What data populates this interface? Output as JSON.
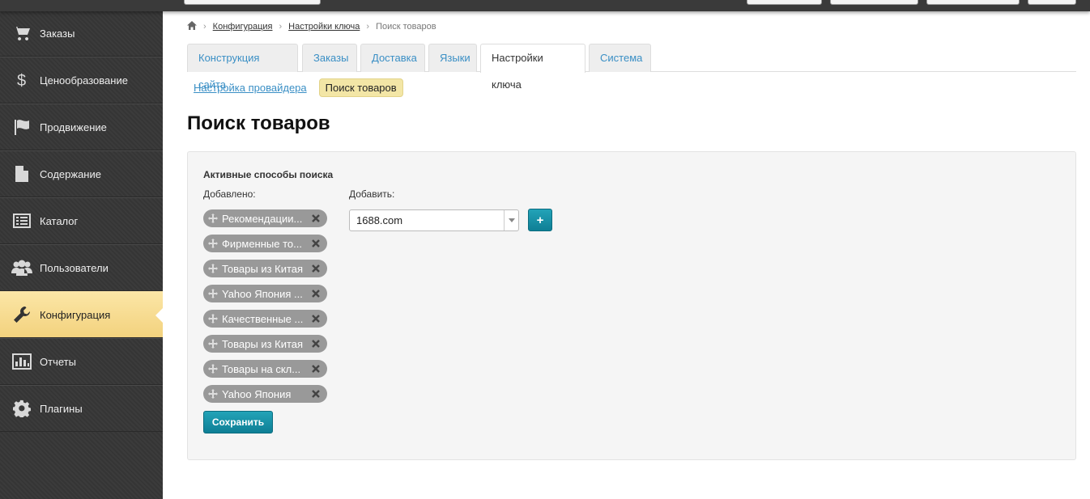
{
  "sidebar": {
    "items": [
      {
        "label": "Заказы",
        "icon": "cart-icon"
      },
      {
        "label": "Ценообразование",
        "icon": "dollar-icon"
      },
      {
        "label": "Продвижение",
        "icon": "flag-icon"
      },
      {
        "label": "Содержание",
        "icon": "file-icon"
      },
      {
        "label": "Каталог",
        "icon": "list-icon"
      },
      {
        "label": "Пользователи",
        "icon": "users-icon"
      },
      {
        "label": "Конфигурация",
        "icon": "wrench-icon",
        "active": true
      },
      {
        "label": "Отчеты",
        "icon": "chart-icon"
      },
      {
        "label": "Плагины",
        "icon": "gear-icon"
      }
    ]
  },
  "breadcrumb": {
    "home_icon": "home-icon",
    "items": [
      "Конфигурация",
      "Настройки ключа",
      "Поиск товаров"
    ]
  },
  "tabs": [
    {
      "label": "Конструкция сайта"
    },
    {
      "label": "Заказы"
    },
    {
      "label": "Доставка"
    },
    {
      "label": "Языки"
    },
    {
      "label": "Настройки ключа",
      "active": true
    },
    {
      "label": "Система"
    }
  ],
  "subnav": {
    "link": "Настройка провайдера",
    "active": "Поиск товаров"
  },
  "page": {
    "title": "Поиск товаров"
  },
  "panel": {
    "title": "Активные способы поиска",
    "added_label": "Добавлено:",
    "add_label": "Добавить:",
    "added_items": [
      "Рекомендации...",
      "Фирменные то...",
      "Товары из Китая",
      "Yahoo Япония ...",
      "Качественные ...",
      "Товары из Китая",
      "Товары на скл...",
      "Yahoo Япония"
    ],
    "select_value": "1688.com",
    "add_button": "+",
    "save_button": "Сохранить"
  },
  "colors": {
    "accent": "#1593a8",
    "active_sidebar": "#f5d88a",
    "link": "#3a8fc5",
    "chip": "#999999"
  }
}
